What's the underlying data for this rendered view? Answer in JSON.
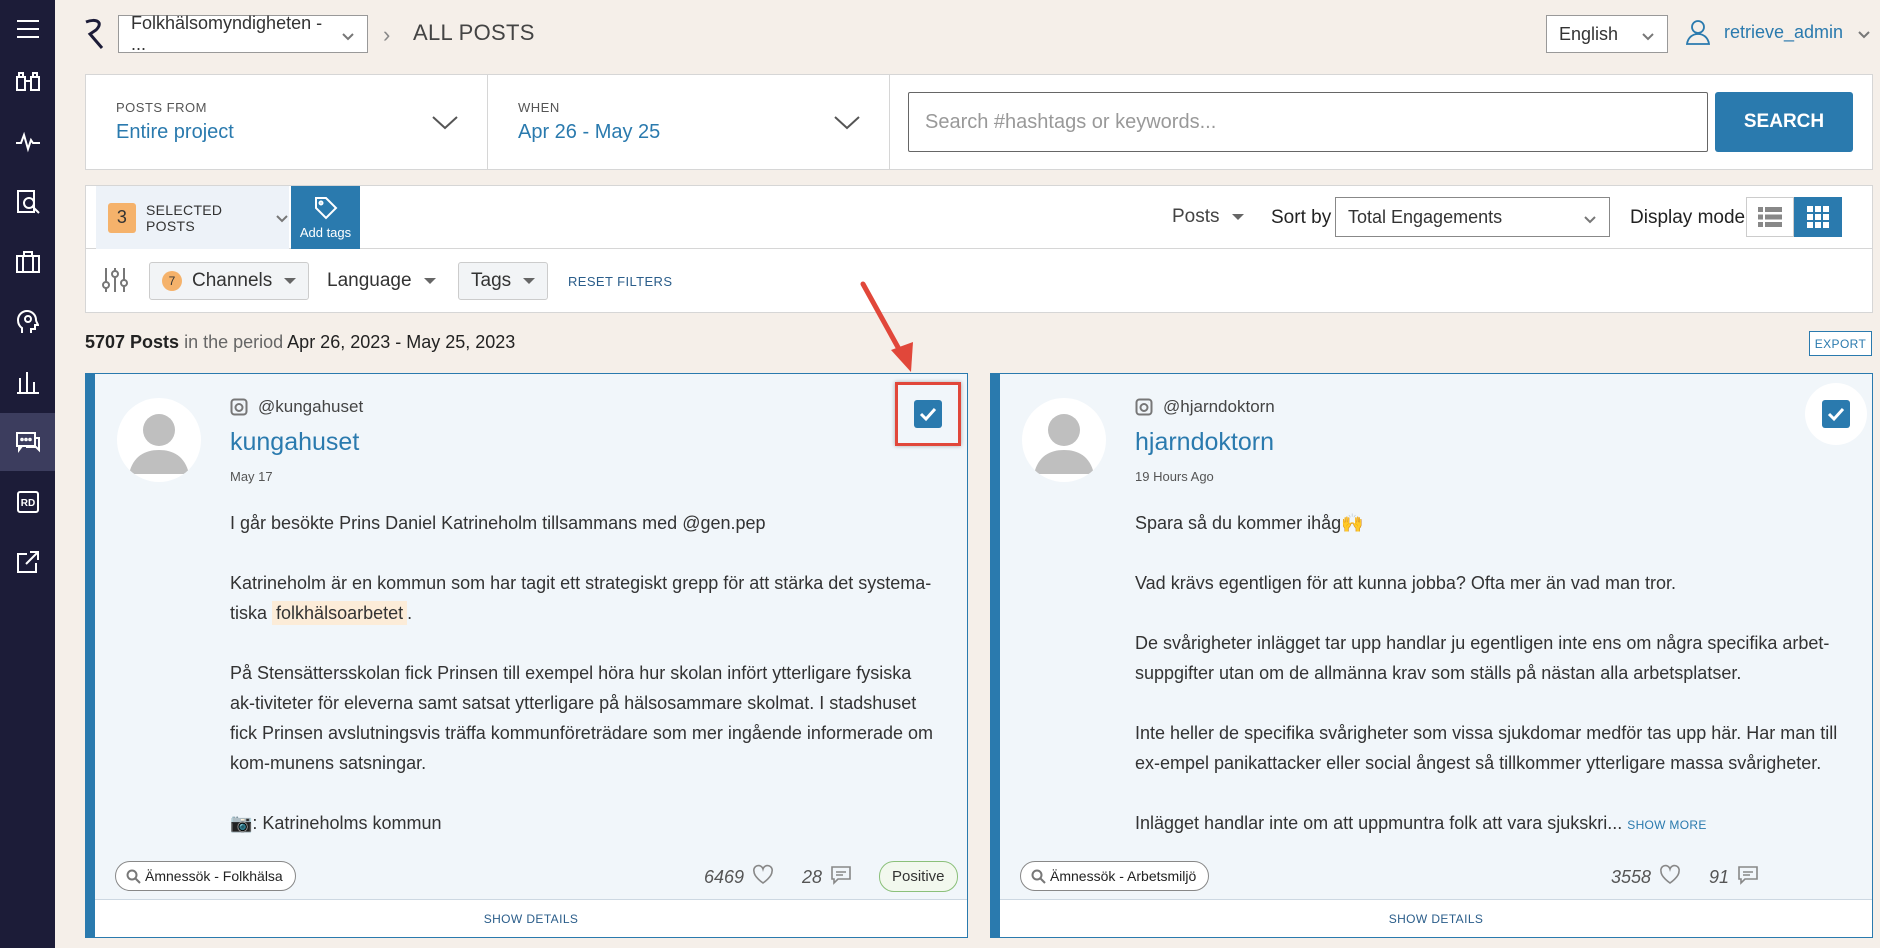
{
  "project_select": "Folkhälsomyndigheten - ...",
  "page_title": "ALL POSTS",
  "language_select": "English",
  "user": "retrieve_admin",
  "filters": {
    "posts_from_label": "POSTS FROM",
    "posts_from_value": "Entire project",
    "when_label": "WHEN",
    "when_value": "Apr 26 - May 25",
    "search_placeholder": "Search #hashtags or keywords...",
    "search_button": "SEARCH"
  },
  "toolbar": {
    "selected_count": "3",
    "selected_label": "SELECTED POSTS",
    "add_tags": "Add tags",
    "posts_dropdown": "Posts",
    "sort_by_label": "Sort by",
    "sort_value": "Total Engagements",
    "display_mode_label": "Display mode"
  },
  "filter_row": {
    "channels_count": "7",
    "channels": "Channels",
    "language": "Language",
    "tags": "Tags",
    "reset": "RESET FILTERS"
  },
  "summary": {
    "count": "5707 Posts",
    "period_prefix": "in the period",
    "period": "Apr 26, 2023 - May 25, 2023",
    "export": "EXPORT"
  },
  "posts": [
    {
      "handle": "@kungahuset",
      "author": "kungahuset",
      "date": "May 17",
      "p1": "I går besökte Prins Daniel Katrineholm tillsammans med @gen.pep",
      "p2_a": "Katrineholm är en kommun som har tagit ett strategiskt grepp för att stärka det systema-tiska",
      "p2_hl": "folkhälsoarbetet",
      "p2_b": ".",
      "p3": "På Stensättersskolan fick Prinsen till exempel höra hur skolan infört ytterligare fysiska ak-tiviteter för eleverna samt satsat ytterligare på hälsosammare skolmat. I stadshuset fick Prinsen avslutningsvis träffa kommunföreträdare som mer ingående informerade om kom-munens satsningar.",
      "p4": "📷: Katrineholms kommun",
      "tag": "Ämnessök - Folkhälsa",
      "likes": "6469",
      "comments": "28",
      "sentiment": "Positive",
      "details": "SHOW DETAILS"
    },
    {
      "handle": "@hjarndoktorn",
      "author": "hjarndoktorn",
      "date": "19 Hours Ago",
      "p1": "Spara så du kommer ihåg🙌",
      "p2": "Vad krävs egentligen för att kunna jobba? Ofta mer än vad man tror.",
      "p3": "De svårigheter inlägget tar upp handlar ju egentligen inte ens om några specifika arbet-suppgifter utan om de allmänna krav som ställs på nästan alla arbetsplatser.",
      "p4": "Inte heller de specifika svårigheter som vissa sjukdomar medför tas upp här. Har man till ex-empel panikattacker eller social ångest så tillkommer ytterligare massa svårigheter.",
      "p5": "Inlägget handlar inte om att uppmuntra folk att vara sjukskri...",
      "show_more": "SHOW MORE",
      "tag": "Ämnessök - Arbetsmiljö",
      "likes": "3558",
      "comments": "91",
      "details": "SHOW DETAILS"
    }
  ],
  "colors": {
    "sidebar": "#1c1c38",
    "accent": "#2a7aae",
    "badge": "#f5b26b",
    "annotation": "#e1473a"
  }
}
